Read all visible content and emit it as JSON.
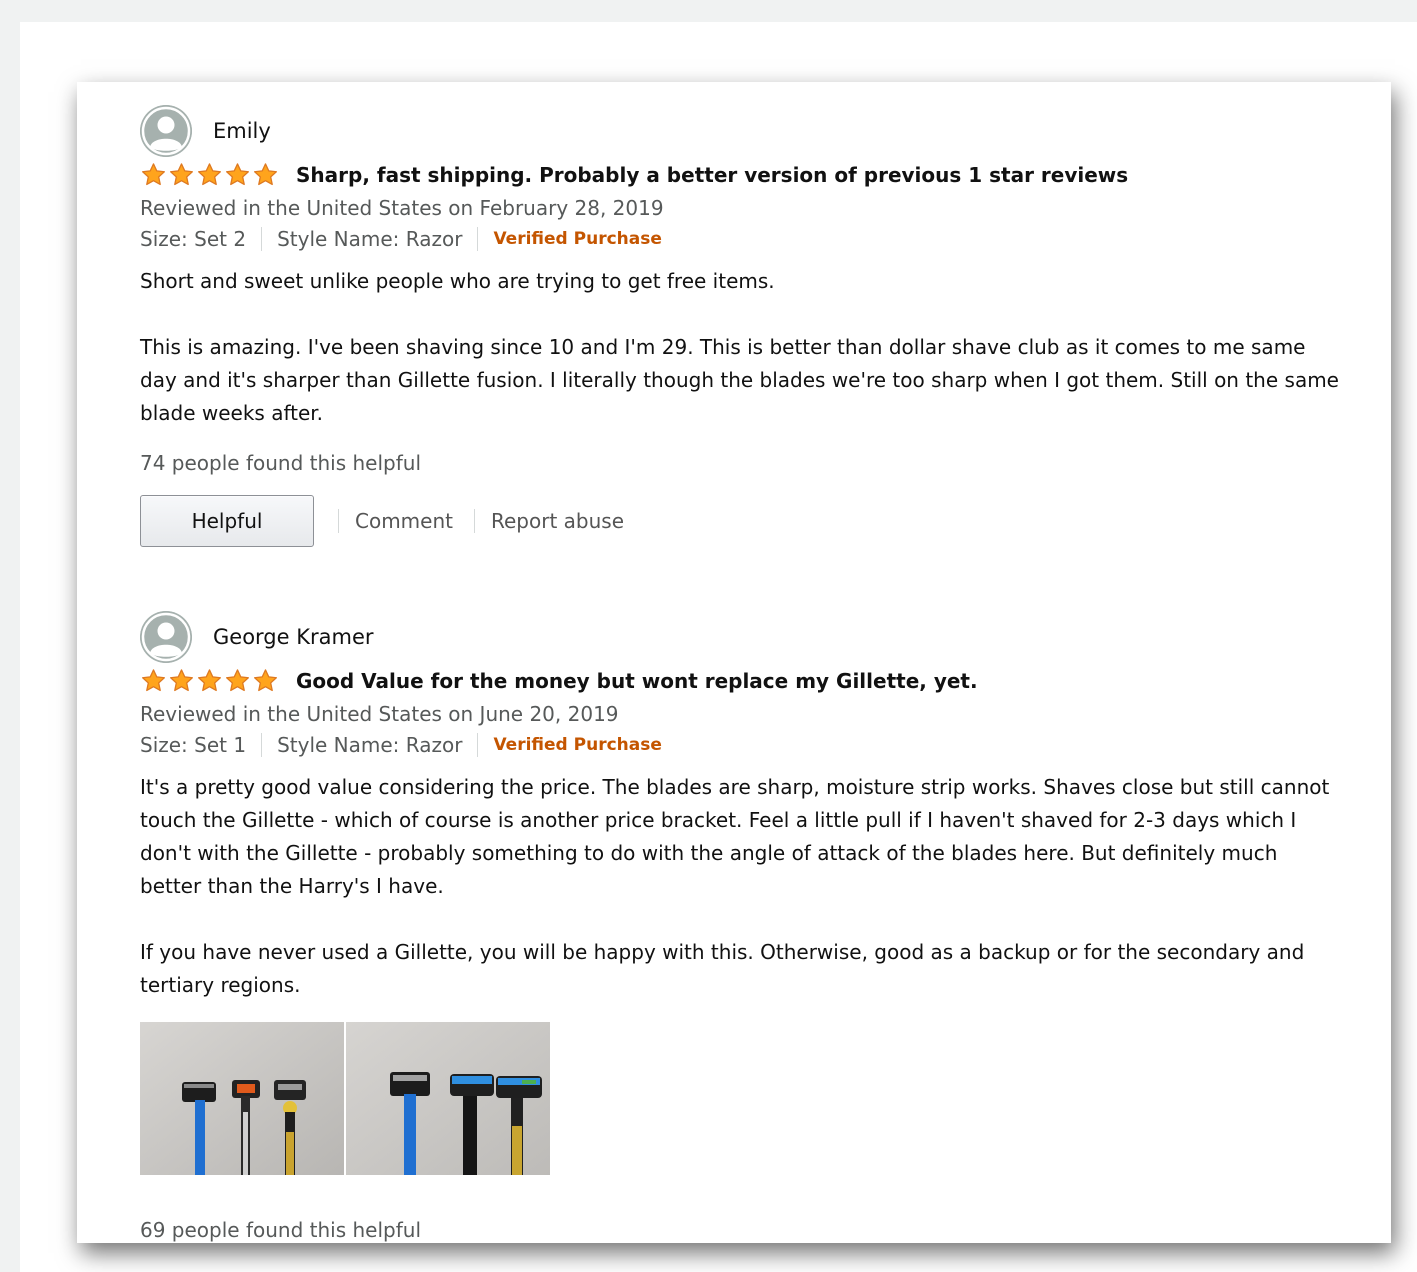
{
  "reviews": [
    {
      "reviewer": "Emily",
      "rating": 5,
      "max_rating": 5,
      "title": "Sharp, fast shipping. Probably a better version of previous 1 star reviews",
      "date": "Reviewed in the United States on February 28, 2019",
      "size": "Size: Set 2",
      "style": "Style Name: Razor",
      "verified": "Verified Purchase",
      "body": [
        "Short and sweet unlike people who are trying to get free items.",
        "This is amazing. I've been shaving since 10 and I'm 29. This is better than dollar shave club as it comes to me same day and it's sharper than Gillette fusion. I literally though the blades we're too sharp when I got them. Still on the same blade weeks after."
      ],
      "helpful_count": "74 people found this helpful",
      "helpful_button": "Helpful",
      "comment_link": "Comment",
      "report_link": "Report abuse"
    },
    {
      "reviewer": "George Kramer",
      "rating": 5,
      "max_rating": 5,
      "title": "Good Value for the money but wont replace my Gillette, yet.",
      "date": "Reviewed in the United States on June 20, 2019",
      "size": "Size: Set 1",
      "style": "Style Name: Razor",
      "verified": "Verified Purchase",
      "body": [
        "It's a pretty good value considering the price. The blades are sharp, moisture strip works. Shaves close but still cannot touch the Gillette - which of course is another price bracket. Feel a little pull if I haven't shaved for 2-3 days which I don't with the Gillette - probably something to do with the angle of attack of the blades here. But definitely much better than the Harry's I have.",
        "If you have never used a Gillette, you will be happy with this. Otherwise, good as a backup or for the secondary and tertiary regions."
      ],
      "photos": [
        "razor-photo-1",
        "razor-photo-2"
      ],
      "helpful_count_partial": "69 people found this helpful"
    }
  ],
  "colors": {
    "star": "#ffa41c",
    "star_outline": "#de7921",
    "verified": "#c45500",
    "secondary_text": "#565959"
  }
}
